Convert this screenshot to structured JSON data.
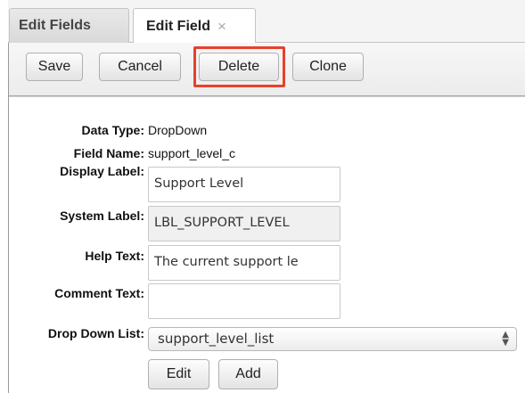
{
  "tabs": [
    {
      "label": "Edit Fields",
      "active": false
    },
    {
      "label": "Edit Field",
      "active": true,
      "close": "×"
    }
  ],
  "toolbar": {
    "save_label": "Save",
    "cancel_label": "Cancel",
    "delete_label": "Delete",
    "clone_label": "Clone",
    "highlight_color": "#e8402b"
  },
  "form": {
    "data_type": {
      "label": "Data Type:",
      "value": "DropDown"
    },
    "field_name": {
      "label": "Field Name:",
      "value": "support_level_c"
    },
    "display_label": {
      "label": "Display Label:",
      "value": "Support Level"
    },
    "system_label": {
      "label": "System Label:",
      "value": "LBL_SUPPORT_LEVEL"
    },
    "help_text": {
      "label": "Help Text:",
      "value": "The current support le"
    },
    "comment_text": {
      "label": "Comment Text:",
      "value": ""
    },
    "drop_down_list": {
      "label": "Drop Down List:",
      "value": "support_level_list"
    },
    "list_actions": {
      "edit_label": "Edit",
      "add_label": "Add"
    }
  }
}
